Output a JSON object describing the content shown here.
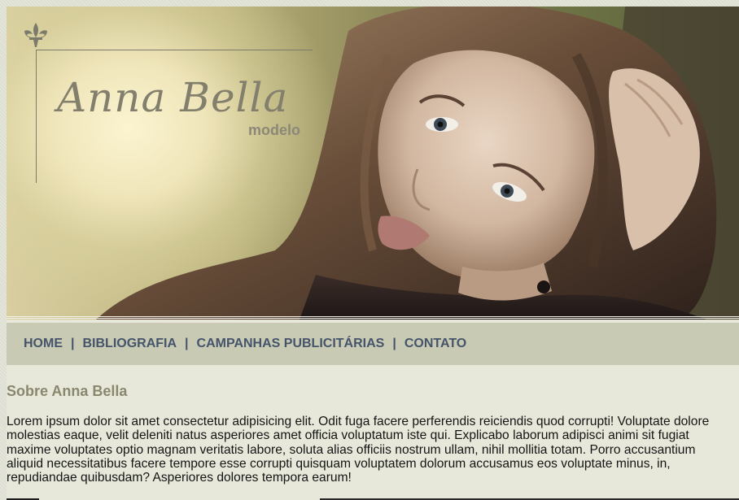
{
  "brand": {
    "name": "Anna Bella",
    "subtitle": "modelo",
    "logo_icon": "fleur-de-lis-icon"
  },
  "hero": {
    "image": "portrait-photo"
  },
  "nav": {
    "items": [
      {
        "label": "HOME"
      },
      {
        "label": "BIBLIOGRAFIA"
      },
      {
        "label": "CAMPANHAS PUBLICITÁRIAS"
      },
      {
        "label": "CONTATO"
      }
    ],
    "separator": "|"
  },
  "about": {
    "title": "Sobre Anna Bella",
    "text": "Lorem ipsum dolor sit amet consectetur adipisicing elit. Odit fuga facere perferendis reiciendis quod corrupti! Voluptate dolore molestias eaque, velit deleniti natus asperiores amet officia voluptatum iste qui. Explicabo laborum adipisci animi sit fugiat maxime voluptates optio magnam veritatis labore, soluta alias officiis nostrum ullam, nihil mollitia totam. Porro accusantium aliquid necessitatibus facere tempore esse corrupti quisquam voluptatem dolorum accusamus eos voluptate minus, in, repudiandae quibusdam? Asperiores dolores tempora earum!"
  },
  "colors": {
    "nav_background": "#c9cab4",
    "nav_text": "#45546a",
    "page_background": "#e7e8da",
    "heading": "#8a876f"
  }
}
